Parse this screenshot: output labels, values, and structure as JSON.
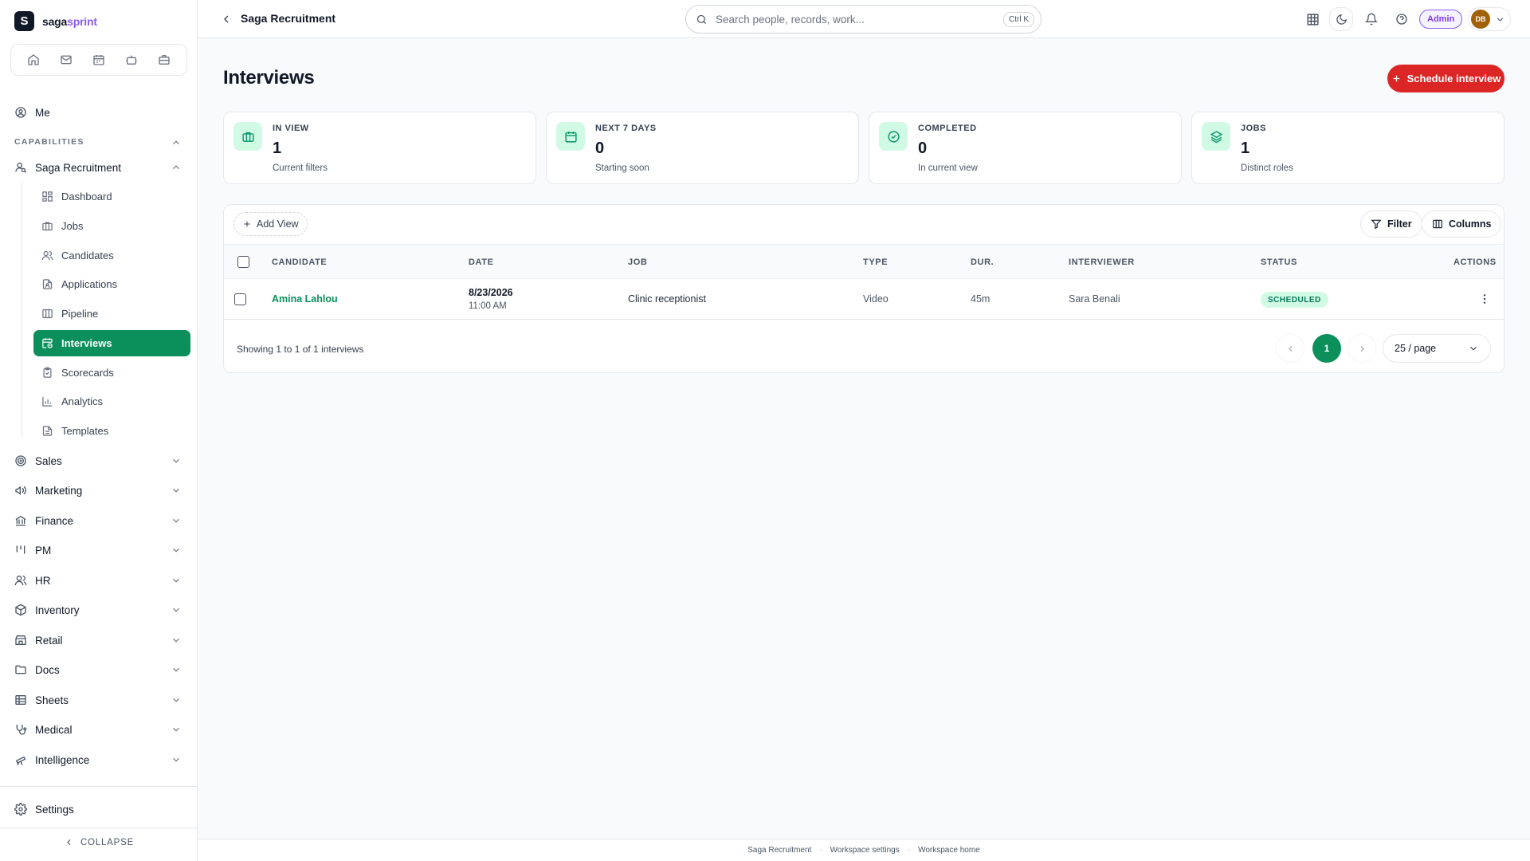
{
  "brand": {
    "name_primary": "saga",
    "name_accent": "sprint",
    "logo_letter": "S"
  },
  "quickbar": [
    {
      "name": "home-icon"
    },
    {
      "name": "mail-icon"
    },
    {
      "name": "calendar-icon"
    },
    {
      "name": "bot-icon"
    },
    {
      "name": "briefcase-icon"
    }
  ],
  "sidebar": {
    "me_label": "Me",
    "capabilities_label": "CAPABILITIES",
    "module_label": "Saga Recruitment",
    "sub_items": [
      {
        "label": "Dashboard",
        "icon": "dashboard-icon"
      },
      {
        "label": "Jobs",
        "icon": "briefcase-icon"
      },
      {
        "label": "Candidates",
        "icon": "users-icon"
      },
      {
        "label": "Applications",
        "icon": "file-user-icon"
      },
      {
        "label": "Pipeline",
        "icon": "columns-icon"
      },
      {
        "label": "Interviews",
        "icon": "calendar-clock-icon",
        "active": true
      },
      {
        "label": "Scorecards",
        "icon": "clipboard-icon"
      },
      {
        "label": "Analytics",
        "icon": "bar-chart-icon"
      },
      {
        "label": "Templates",
        "icon": "document-icon"
      }
    ],
    "sections": [
      {
        "label": "Sales",
        "icon": "target-icon"
      },
      {
        "label": "Marketing",
        "icon": "megaphone-icon"
      },
      {
        "label": "Finance",
        "icon": "bank-icon"
      },
      {
        "label": "PM",
        "icon": "kanban-icon"
      },
      {
        "label": "HR",
        "icon": "people-icon"
      },
      {
        "label": "Inventory",
        "icon": "package-icon"
      },
      {
        "label": "Retail",
        "icon": "store-icon"
      },
      {
        "label": "Docs",
        "icon": "folder-icon"
      },
      {
        "label": "Sheets",
        "icon": "table-icon"
      },
      {
        "label": "Medical",
        "icon": "stethoscope-icon"
      },
      {
        "label": "Intelligence",
        "icon": "telescope-icon"
      }
    ],
    "settings_label": "Settings",
    "collapse_label": "COLLAPSE"
  },
  "topbar": {
    "title": "Saga Recruitment",
    "search_placeholder": "Search people, records, work...",
    "search_shortcut": "Ctrl K",
    "admin_label": "Admin",
    "avatar_initials": "DB"
  },
  "page": {
    "title": "Interviews",
    "primary_action": "Schedule interview"
  },
  "stats": [
    {
      "label": "IN VIEW",
      "value": "1",
      "sub": "Current filters",
      "icon": "briefcase-icon"
    },
    {
      "label": "NEXT 7 DAYS",
      "value": "0",
      "sub": "Starting soon",
      "icon": "calendar-icon"
    },
    {
      "label": "COMPLETED",
      "value": "0",
      "sub": "In current view",
      "icon": "check-circle-icon"
    },
    {
      "label": "JOBS",
      "value": "1",
      "sub": "Distinct roles",
      "icon": "layers-icon"
    }
  ],
  "table": {
    "add_view_label": "Add View",
    "filter_label": "Filter",
    "columns_label": "Columns",
    "headers": [
      "CANDIDATE",
      "DATE",
      "JOB",
      "TYPE",
      "DUR.",
      "INTERVIEWER",
      "STATUS",
      "ACTIONS"
    ],
    "rows": [
      {
        "candidate": "Amina Lahlou",
        "date": "8/23/2026",
        "time": "11:00 AM",
        "job": "Clinic receptionist",
        "type": "Video",
        "duration": "45m",
        "interviewer": "Sara Benali",
        "status": "SCHEDULED"
      }
    ],
    "showing": "Showing 1 to 1 of 1 interviews",
    "current_page": "1",
    "per_page": "25 / page"
  },
  "footer": {
    "links": [
      "Saga Recruitment",
      "Workspace settings",
      "Workspace home"
    ],
    "separator": "·"
  },
  "colors": {
    "accent_green": "#0b8f5b",
    "primary_red": "#dc2626",
    "brand_purple": "#8b5cf6"
  }
}
